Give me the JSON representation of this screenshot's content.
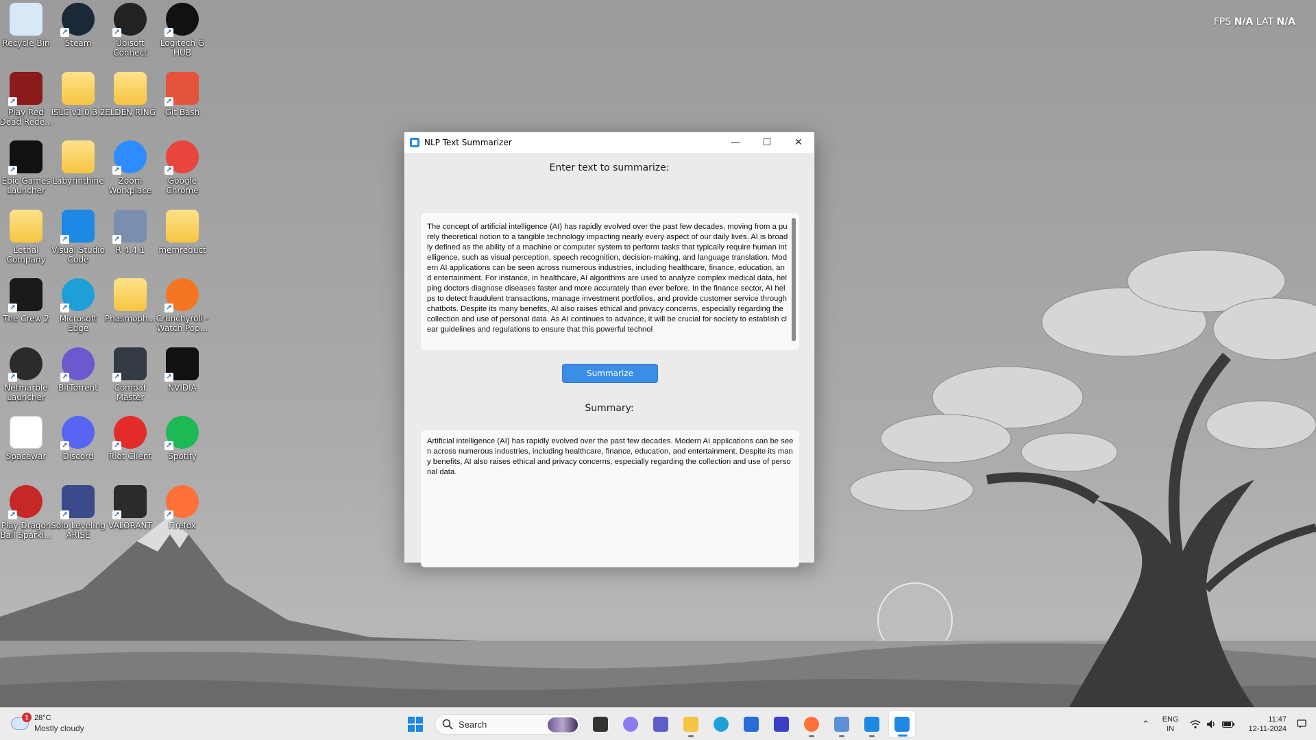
{
  "desktop": {
    "icons": [
      {
        "label": "Recycle Bin",
        "icon": "recycle-bin-icon",
        "color": "#d9e8f5"
      },
      {
        "label": "Steam",
        "icon": "steam-icon",
        "color": "#1b2838"
      },
      {
        "label": "Ubisoft Connect",
        "icon": "ubisoft-icon",
        "color": "#222222"
      },
      {
        "label": "Logitech G HUB",
        "icon": "logitech-icon",
        "color": "#111111"
      },
      {
        "label": "Play Red Dead Rede...",
        "icon": "red-dead-icon",
        "color": "#8b1a1a"
      },
      {
        "label": "ISLC v1.0.3.2",
        "icon": "folder-icon",
        "color": "#f5c542"
      },
      {
        "label": "ELDEN RING",
        "icon": "folder-icon",
        "color": "#f5c542"
      },
      {
        "label": "Git Bash",
        "icon": "git-bash-icon",
        "color": "#e5533d"
      },
      {
        "label": "Epic Games Launcher",
        "icon": "epic-games-icon",
        "color": "#111111"
      },
      {
        "label": "Labyrinthine",
        "icon": "folder-icon",
        "color": "#f5c542"
      },
      {
        "label": "Zoom Workplace",
        "icon": "zoom-icon",
        "color": "#2d8cff"
      },
      {
        "label": "Google Chrome",
        "icon": "chrome-icon",
        "color": "#e8453c"
      },
      {
        "label": "Lethal Company",
        "icon": "folder-icon",
        "color": "#f5c542"
      },
      {
        "label": "Visual Studio Code",
        "icon": "vscode-icon",
        "color": "#1e88e5"
      },
      {
        "label": "R 4.4.1",
        "icon": "r-icon",
        "color": "#7a8fb0"
      },
      {
        "label": "memreduct",
        "icon": "folder-icon",
        "color": "#f5c542"
      },
      {
        "label": "The Crew 2",
        "icon": "crew2-icon",
        "color": "#1a1a1a"
      },
      {
        "label": "Microsoft Edge",
        "icon": "edge-icon",
        "color": "#1f9fd8"
      },
      {
        "label": "Phasmoph...",
        "icon": "folder-icon",
        "color": "#f5c542"
      },
      {
        "label": "Crunchyroll - Watch Pop...",
        "icon": "crunchyroll-icon",
        "color": "#f47521"
      },
      {
        "label": "Netmarble Launcher",
        "icon": "netmarble-icon",
        "color": "#2b2b2b"
      },
      {
        "label": "BitTorrent",
        "icon": "bittorrent-icon",
        "color": "#6a5acd"
      },
      {
        "label": "Combat Master",
        "icon": "combat-master-icon",
        "color": "#333a44"
      },
      {
        "label": "NVIDIA",
        "icon": "nvidia-icon",
        "color": "#111111"
      },
      {
        "label": "Spacewar",
        "icon": "file-icon",
        "color": "#ffffff"
      },
      {
        "label": "Discord",
        "icon": "discord-icon",
        "color": "#5865f2"
      },
      {
        "label": "Riot Client",
        "icon": "riot-icon",
        "color": "#e52a2a"
      },
      {
        "label": "Spotify",
        "icon": "spotify-icon",
        "color": "#1db954"
      },
      {
        "label": "Play Dragon Ball Sparki...",
        "icon": "dragon-ball-icon",
        "color": "#c62828"
      },
      {
        "label": "Solo Leveling ARISE",
        "icon": "solo-leveling-icon",
        "color": "#3b4a8a"
      },
      {
        "label": "VALORANT",
        "icon": "valorant-icon",
        "color": "#2b2b2b"
      },
      {
        "label": "Firefox",
        "icon": "firefox-icon",
        "color": "#ff7139"
      }
    ]
  },
  "overlay": {
    "fps_label": "FPS",
    "fps_value": "N/A",
    "lat_label": "LAT",
    "lat_value": "N/A"
  },
  "window": {
    "title": "NLP Text Summarizer",
    "minimize": "—",
    "maximize": "☐",
    "close": "✕",
    "input_label": "Enter text to summarize:",
    "input_text": "The concept of artificial intelligence (AI) has rapidly evolved over the past few decades, moving from a purely theoretical notion to a tangible technology impacting nearly every aspect of our daily lives. AI is broadly defined as the ability of a machine or computer system to perform tasks that typically require human intelligence, such as visual perception, speech recognition, decision-making, and language translation. Modern AI applications can be seen across numerous industries, including healthcare, finance, education, and entertainment. For instance, in healthcare, AI algorithms are used to analyze complex medical data, helping doctors diagnose diseases faster and more accurately than ever before. In the finance sector, AI helps to detect fraudulent transactions, manage investment portfolios, and provide customer service through chatbots. Despite its many benefits, AI also raises ethical and privacy concerns, especially regarding the collection and use of personal data. As AI continues to advance, it will be crucial for society to establish clear guidelines and regulations to ensure that this powerful technol",
    "summarize_button": "Summarize",
    "summary_label": "Summary:",
    "summary_text": "Artificial intelligence (AI) has rapidly evolved over the past few decades. Modern AI applications can be seen across numerous industries, including healthcare, finance, education, and entertainment. Despite its many benefits, AI also raises ethical and privacy concerns, especially regarding the collection and use of personal data."
  },
  "taskbar": {
    "weather_temp": "28°C",
    "weather_desc": "Mostly cloudy",
    "weather_badge": "1",
    "search_placeholder": "Search",
    "apps": [
      {
        "name": "file-manager-icon",
        "color": "#333333",
        "running": false
      },
      {
        "name": "copilot-icon",
        "color": "#8a7cf0",
        "running": false
      },
      {
        "name": "teams-icon",
        "color": "#5b5fc7",
        "running": false
      },
      {
        "name": "file-explorer-icon",
        "color": "#f5c542",
        "running": true
      },
      {
        "name": "edge-icon",
        "color": "#1f9fd8",
        "running": false
      },
      {
        "name": "ms-store-icon",
        "color": "#2a6bd6",
        "running": false
      },
      {
        "name": "vscode-insiders-icon",
        "color": "#3b3fc7",
        "running": false
      },
      {
        "name": "firefox-icon",
        "color": "#ff7139",
        "running": true
      },
      {
        "name": "task-manager-icon",
        "color": "#5c8fd6",
        "running": true
      },
      {
        "name": "vscode-icon",
        "color": "#1e88e5",
        "running": true
      },
      {
        "name": "nlp-summarizer-icon",
        "color": "#1e88e5",
        "running": true,
        "active": true
      }
    ],
    "lang_top": "ENG",
    "lang_bottom": "IN",
    "time": "11:47",
    "date": "12-11-2024"
  }
}
